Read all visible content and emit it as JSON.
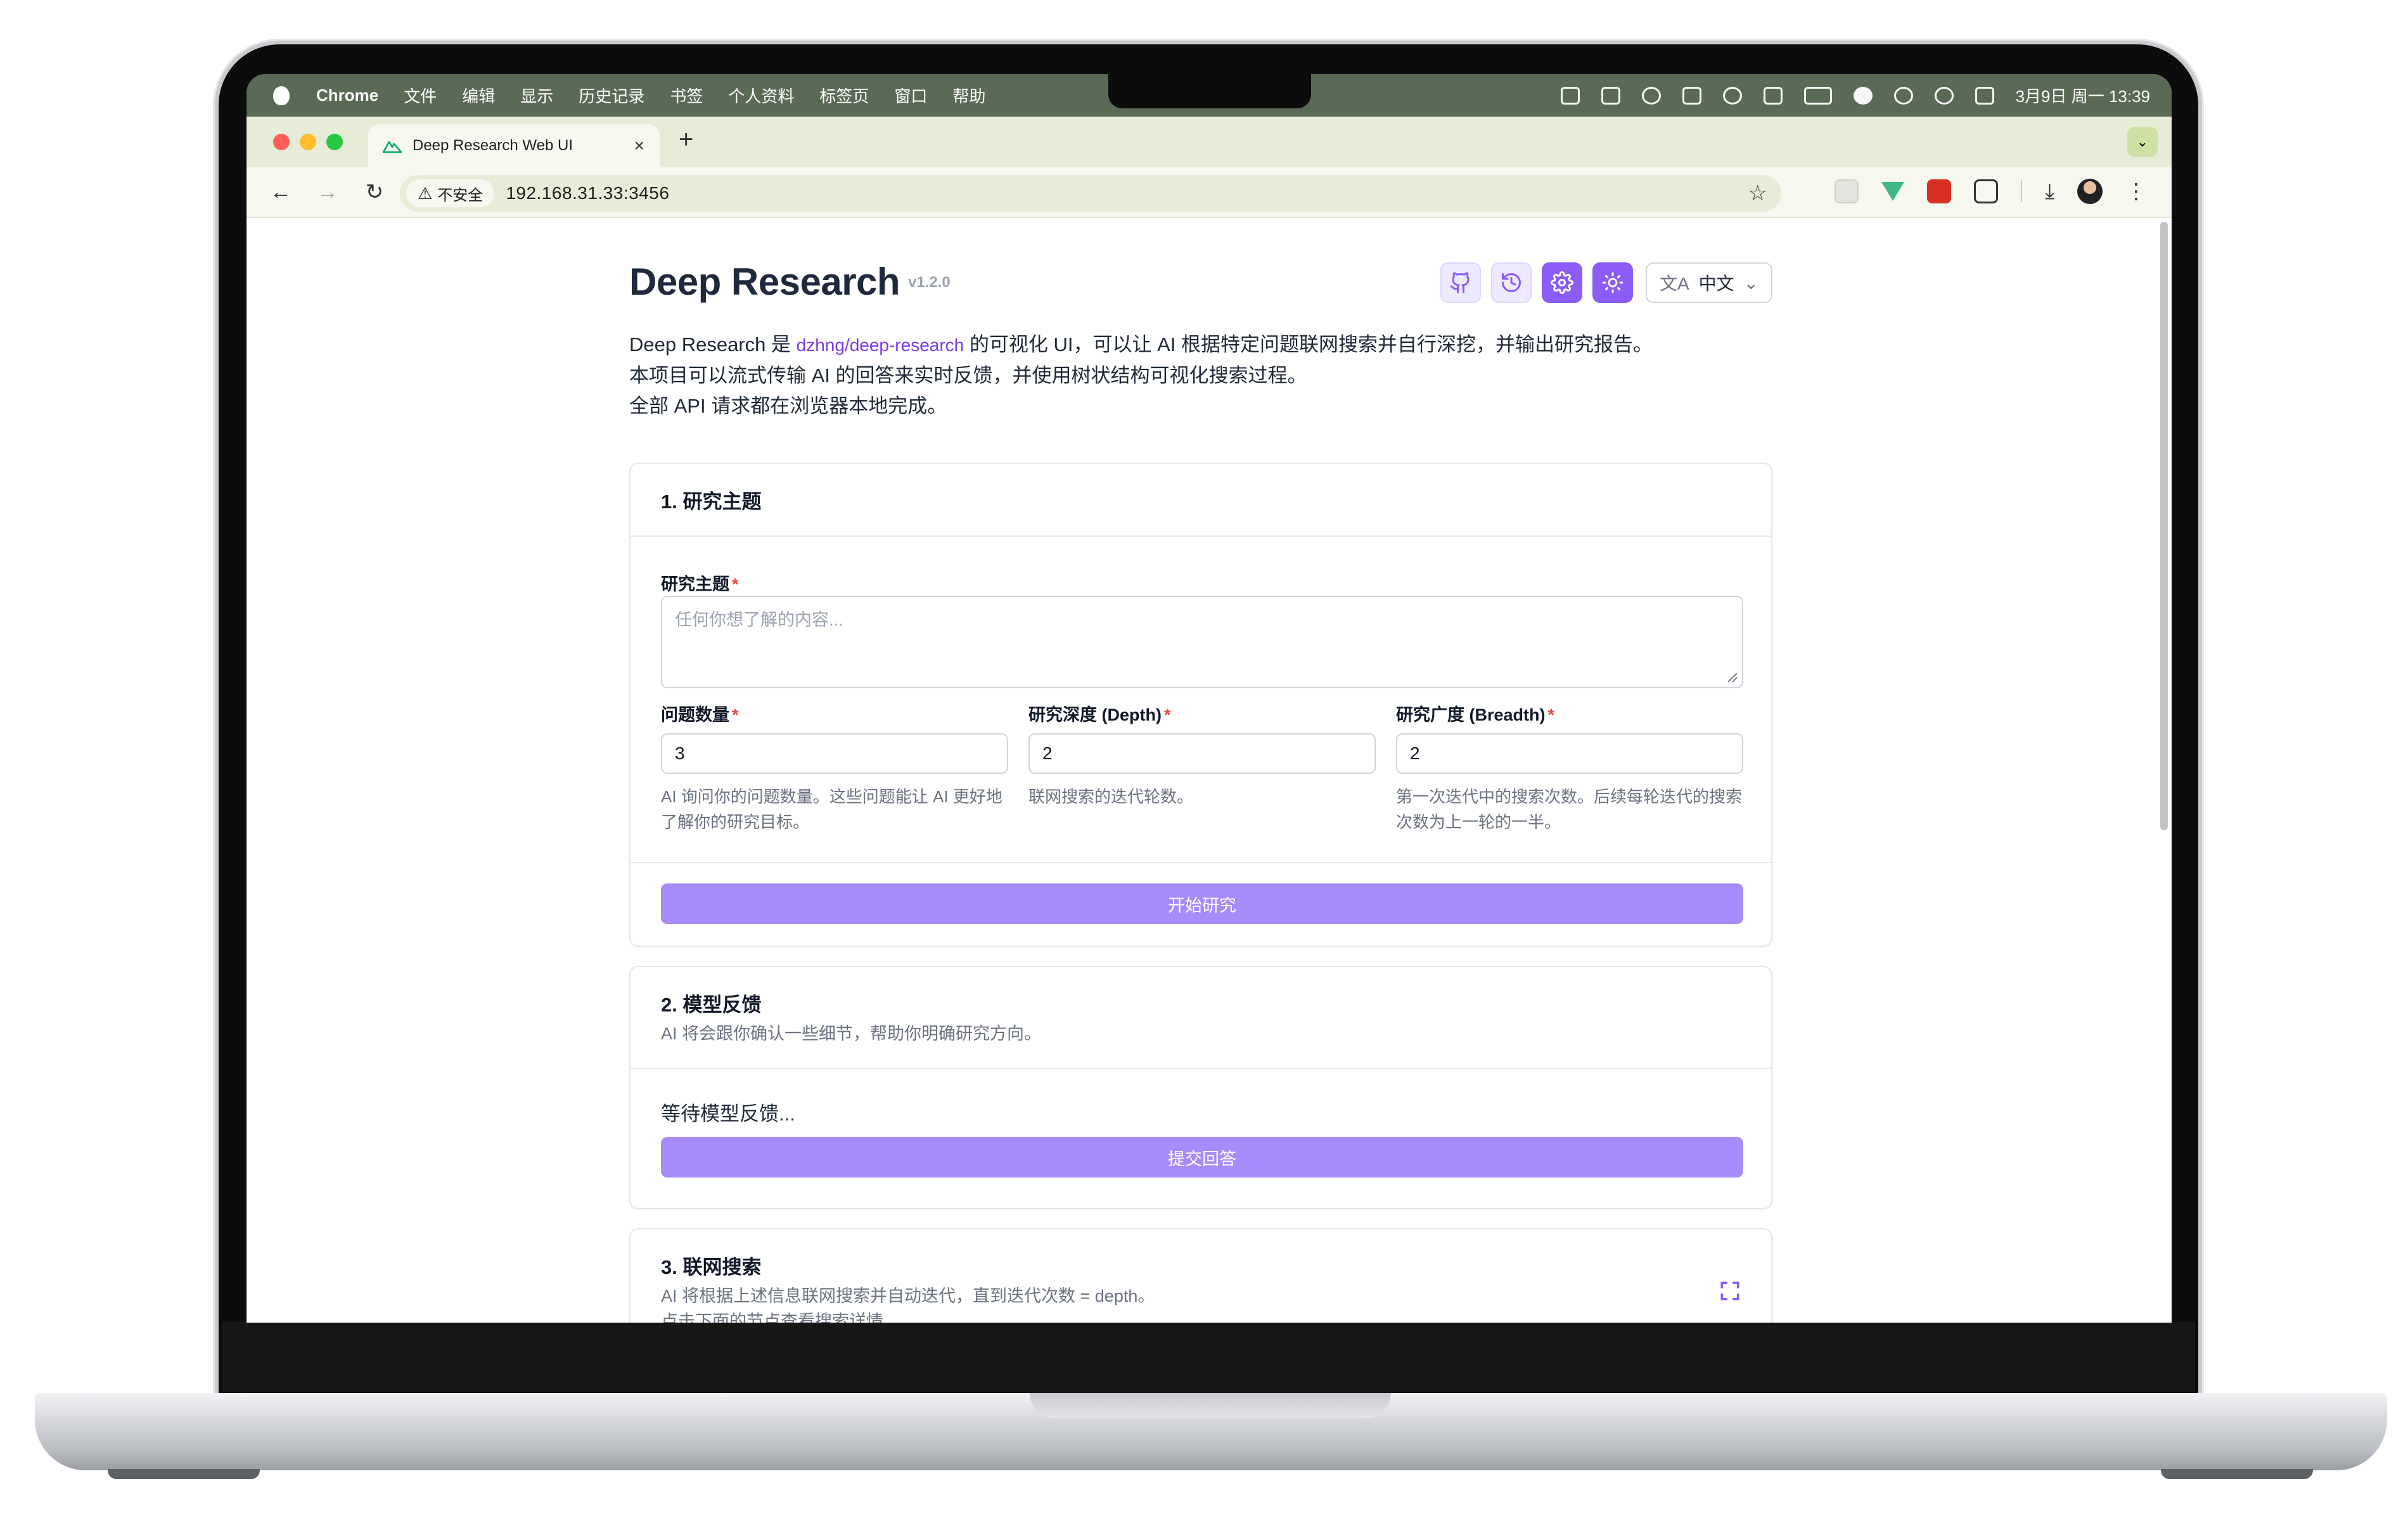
{
  "menubar": {
    "app_name": "Chrome",
    "items": [
      "文件",
      "编辑",
      "显示",
      "历史记录",
      "书签",
      "个人资料",
      "标签页",
      "窗口",
      "帮助"
    ],
    "clock": "3月9日 周一  13:39"
  },
  "browser": {
    "tab_title": "Deep Research Web UI",
    "tab_close": "×",
    "new_tab": "+",
    "tab_dropdown": "⌄",
    "back": "←",
    "forward": "→",
    "reload": "↻",
    "security_label": "不安全",
    "warning_glyph": "⚠",
    "url": "192.168.31.33:3456",
    "star_glyph": "☆",
    "download_glyph": "⤓",
    "menu_glyph": "⋮"
  },
  "header": {
    "title": "Deep Research",
    "version": "v1.2.0",
    "language": "中文",
    "lang_icon": "文A",
    "lang_chevron": "⌄"
  },
  "intro": {
    "line1_prefix": "Deep Research 是 ",
    "link_text": "dzhng/deep-research",
    "line1_suffix": " 的可视化 UI，可以让 AI 根据特定问题联网搜索并自行深挖，并输出研究报告。",
    "line2": "本项目可以流式传输 AI 的回答来实时反馈，并使用树状结构可视化搜索过程。",
    "line3": "全部 API 请求都在浏览器本地完成。"
  },
  "research_topic_card": {
    "title": "1. 研究主题",
    "topic_label": "研究主题",
    "required_mark": "*",
    "topic_placeholder": "任何你想了解的内容...",
    "question_count_label": "问题数量",
    "question_count_value": "3",
    "question_count_hint": "AI 询问你的问题数量。这些问题能让 AI 更好地了解你的研究目标。",
    "depth_label": "研究深度 (Depth)",
    "depth_value": "2",
    "depth_hint": "联网搜索的迭代轮数。",
    "breadth_label": "研究广度 (Breadth)",
    "breadth_value": "2",
    "breadth_hint": "第一次迭代中的搜索次数。后续每轮迭代的搜索次数为上一轮的一半。",
    "start_button": "开始研究"
  },
  "feedback_card": {
    "title": "2. 模型反馈",
    "description": "AI 将会跟你确认一些细节，帮助你明确研究方向。",
    "waiting_text": "等待模型反馈...",
    "submit_button": "提交回答"
  },
  "search_card": {
    "title": "3. 联网搜索",
    "description_line1": "AI 将根据上述信息联网搜索并自动迭代，直到迭代次数 = depth。",
    "description_line2": "点击下面的节点查看搜索详情。"
  },
  "colors": {
    "accent": "#8b5cf6",
    "accent_light": "#a78bfa",
    "link": "#7c3aed",
    "required": "#ef4444",
    "menubar": "#5a6b55",
    "tabstrip": "#e7ecd6"
  },
  "icons": {
    "header_buttons": [
      "github-icon",
      "history-icon",
      "settings-icon",
      "theme-sun-icon"
    ],
    "expand": "fullscreen-icon"
  }
}
